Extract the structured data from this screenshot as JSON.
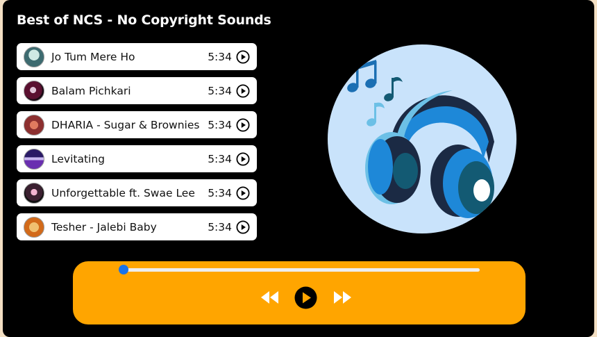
{
  "playlist_title": "Best of NCS - No Copyright Sounds",
  "songs": [
    {
      "name": "Jo Tum Mere Ho",
      "duration": "5:34"
    },
    {
      "name": "Balam Pichkari",
      "duration": "5:34"
    },
    {
      "name": "DHARIA - Sugar & Brownies",
      "duration": "5:34"
    },
    {
      "name": "Levitating",
      "duration": "5:34"
    },
    {
      "name": "Unforgettable ft. Swae Lee",
      "duration": "5:34"
    },
    {
      "name": "Tesher - Jalebi Baby",
      "duration": "5:34"
    }
  ],
  "progress": 0,
  "colors": {
    "background": "#000000",
    "controls_bar": "#ffa500",
    "progress_knob": "#1a73e8",
    "art_circle": "#c9e3fb"
  },
  "icons": {
    "song_play": "play-circle-icon",
    "previous": "rewind-icon",
    "play": "play-icon",
    "next": "fast-forward-icon",
    "album_art": "headphones-icon"
  }
}
